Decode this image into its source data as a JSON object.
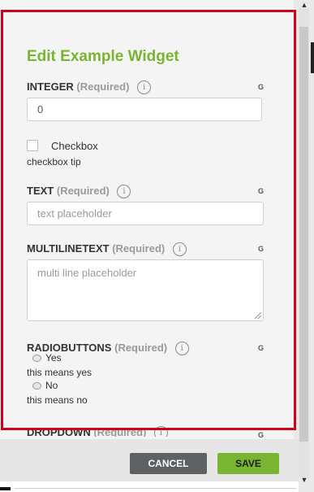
{
  "dialog": {
    "title": "Edit Example Widget"
  },
  "fields": {
    "integer": {
      "label": "INTEGER",
      "required": "(Required)",
      "info_icon": "i",
      "flag": "G",
      "value": "0"
    },
    "checkbox": {
      "label": "Checkbox",
      "tip": "checkbox tip",
      "checked": false
    },
    "text": {
      "label": "TEXT",
      "required": "(Required)",
      "info_icon": "i",
      "flag": "G",
      "placeholder": "text placeholder"
    },
    "multilinetext": {
      "label": "MULTILINETEXT",
      "required": "(Required)",
      "info_icon": "i",
      "flag": "G",
      "placeholder": "multi line placeholder"
    },
    "radiobuttons": {
      "label": "RADIOBUTTONS",
      "required": "(Required)",
      "info_icon": "i",
      "flag": "G",
      "options": [
        {
          "label": "Yes",
          "description": "this means yes"
        },
        {
          "label": "No",
          "description": "this means no"
        }
      ]
    },
    "dropdown": {
      "label": "DROPDOWN",
      "required": "(Required)",
      "info_icon": "i",
      "flag": "G"
    }
  },
  "footer": {
    "cancel_label": "CANCEL",
    "save_label": "SAVE"
  },
  "scrollbar": {
    "up_glyph": "▲",
    "down_glyph": "▼"
  },
  "colors": {
    "accent": "#7ab532",
    "highlight_frame": "#d0021b",
    "cancel_button": "#5d6164",
    "panel_background": "#f4f4f4"
  },
  "icons": {
    "info": "info-circle-icon",
    "resize": "resize-grip-icon"
  }
}
